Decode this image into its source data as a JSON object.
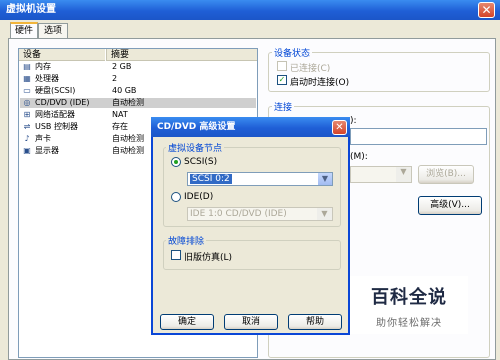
{
  "main_window": {
    "title": "虚拟机设置",
    "close_glyph": "✕",
    "tabs": [
      {
        "label": "硬件",
        "active": true
      },
      {
        "label": "选项",
        "active": false
      }
    ]
  },
  "device_list": {
    "headers": {
      "device": "设备",
      "summary": "摘要"
    },
    "rows": [
      {
        "icon": "memory-icon",
        "name": "内存",
        "summary": "2 GB"
      },
      {
        "icon": "processor-icon",
        "name": "处理器",
        "summary": "2"
      },
      {
        "icon": "hard-disk-icon",
        "name": "硬盘(SCSI)",
        "summary": "40 GB"
      },
      {
        "icon": "cd-dvd-icon",
        "name": "CD/DVD (IDE)",
        "summary": "自动检测",
        "selected": true
      },
      {
        "icon": "network-adapter-icon",
        "name": "网络适配器",
        "summary": "NAT"
      },
      {
        "icon": "usb-controller-icon",
        "name": "USB 控制器",
        "summary": "存在"
      },
      {
        "icon": "sound-card-icon",
        "name": "声卡",
        "summary": "自动检测"
      },
      {
        "icon": "display-icon",
        "name": "显示器",
        "summary": "自动检测"
      }
    ]
  },
  "device_status": {
    "title": "设备状态",
    "connected_label": "已连接(C)",
    "connected_checked": false,
    "connect_at_power_on_label": "启动时连接(O)",
    "connect_at_power_on_checked": true
  },
  "connection": {
    "title": "连接",
    "partial_label_1": "):",
    "partial_label_2": "(M):",
    "browse_label": "浏览(B)...",
    "advanced_label": "高级(V)..."
  },
  "dialog": {
    "title": "CD/DVD 高级设置",
    "close_glyph": "✕",
    "node_group_title": "虚拟设备节点",
    "scsi_label": "SCSI(S)",
    "scsi_selected": true,
    "scsi_value": "SCSI 0:2",
    "ide_label": "IDE(D)",
    "ide_selected": false,
    "ide_value": "IDE 1:0   CD/DVD (IDE)",
    "troubleshoot_group_title": "故障排除",
    "legacy_label": "旧版仿真(L)",
    "legacy_checked": false,
    "ok_label": "确定",
    "cancel_label": "取消",
    "help_label": "帮助"
  },
  "watermark": {
    "title": "百科全说",
    "subtitle": "助你轻松解决"
  },
  "colors": {
    "titlebar": "#1f5fd6",
    "group_title": "#0046d5",
    "selection": "#cfcfcf"
  }
}
